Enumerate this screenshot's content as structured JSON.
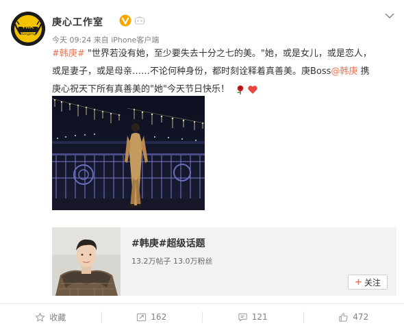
{
  "post": {
    "author": {
      "name": "庚心工作室",
      "verified_icon": "verified-badge-icon",
      "member_icon": "member-icon",
      "logo_text": "韩庚",
      "logo_subtext": "Hangeng"
    },
    "meta": "今天 09:24 来自 iPhone客户端",
    "text": {
      "hashtag": "#韩庚#",
      "line1_rest": " \"世界若没有她，至少要失去十分之七的美。\"她，或是女儿，或是恋人，",
      "line2": "或是妻子，或是母亲……不论何种身份，都时刻诠释着真善美。庚Boss",
      "mention": "@韩庚",
      "line2_end": " 携",
      "line3": "庚心祝天下所有真善美的\"她\"今天节日快乐！",
      "emoji_rose": "rose-emoji",
      "emoji_heart": "heart-emoji"
    },
    "image_alt": "photo",
    "topic": {
      "title": "#韩庚#超级话题",
      "stats": "13.2万帖子 13.0万粉丝",
      "follow_label": "关注",
      "follow_prefix": "+"
    }
  },
  "actions": {
    "favorite": {
      "label": "收藏",
      "icon": "star-icon"
    },
    "repost": {
      "label": "162",
      "icon": "repost-icon"
    },
    "comment": {
      "label": "121",
      "icon": "comment-icon"
    },
    "like": {
      "label": "472",
      "icon": "thumbs-up-icon"
    }
  },
  "colors": {
    "link": "#eb7350",
    "verified": "#f7a700",
    "text": "#333333",
    "muted": "#808080"
  }
}
